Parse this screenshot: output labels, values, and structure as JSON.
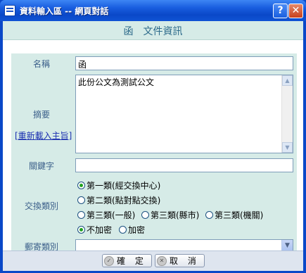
{
  "window": {
    "title": "資料輸入區 -- 網頁對話",
    "help_label": "?",
    "close_label": "✕"
  },
  "header": {
    "title": "函　文件資訊"
  },
  "form": {
    "name": {
      "label": "名稱",
      "value": "函"
    },
    "summary": {
      "label": "摘要",
      "value": "此份公文為測試公文",
      "reload_link": "[重新載入主旨]"
    },
    "keywords": {
      "label": "關鍵字",
      "value": ""
    },
    "exchange": {
      "label": "交換類別",
      "options": [
        "第一類(經交換中心)",
        "第二類(點對點交換)",
        "第三類(一般)",
        "第三類(縣市)",
        "第三類(機關)"
      ],
      "selected": "第一類(經交換中心)",
      "encrypt_options": [
        "不加密",
        "加密"
      ],
      "encrypt_selected": "不加密"
    },
    "mail": {
      "label": "郵寄類別",
      "value": ""
    }
  },
  "footer": {
    "ok_label": "確 定",
    "cancel_label": "取 消"
  }
}
